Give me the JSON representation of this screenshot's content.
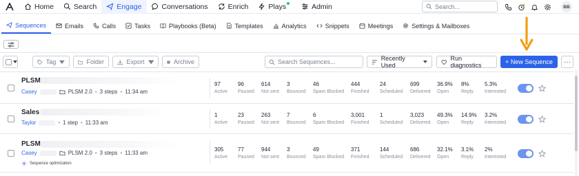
{
  "topnav": {
    "items": [
      {
        "label": "Home",
        "icon": "home-icon"
      },
      {
        "label": "Search",
        "icon": "search-icon"
      },
      {
        "label": "Engage",
        "icon": "engage-icon",
        "active": true
      },
      {
        "label": "Conversations",
        "icon": "chat-icon"
      },
      {
        "label": "Enrich",
        "icon": "enrich-icon"
      },
      {
        "label": "Plays",
        "icon": "bolt-icon"
      },
      {
        "label": "Admin",
        "icon": "admin-icon"
      }
    ],
    "search_placeholder": "Search...",
    "avatar_initials": "BB",
    "accent_color": "#2d5fe8"
  },
  "subnav": {
    "items": [
      {
        "label": "Sequences",
        "active": true
      },
      {
        "label": "Emails"
      },
      {
        "label": "Calls"
      },
      {
        "label": "Tasks"
      },
      {
        "label": "Playbooks (Beta)"
      },
      {
        "label": "Templates"
      },
      {
        "label": "Analytics"
      },
      {
        "label": "Snippets"
      },
      {
        "label": "Meetings"
      },
      {
        "label": "Settings & Mailboxes"
      }
    ]
  },
  "toolbar": {
    "tag_label": "Tag",
    "folder_label": "Folder",
    "export_label": "Export",
    "archive_label": "Archive",
    "search_placeholder": "Search Sequences...",
    "sort_label": "Recently Used",
    "diagnostics_label": "Run diagnostics",
    "new_sequence_label": "+ New Sequence",
    "more_label": "···",
    "button_color": "#2d63e8",
    "annotation_arrow_color": "#f39c12"
  },
  "sequences": [
    {
      "name": "PLSM",
      "owner": "Casey",
      "folder": "PLSM 2.0",
      "steps": "3 steps",
      "time": "11:34 am",
      "optimization": "",
      "stats": [
        {
          "value": "97",
          "label": "Active"
        },
        {
          "value": "96",
          "label": "Paused"
        },
        {
          "value": "614",
          "label": "Not sent"
        },
        {
          "value": "3",
          "label": "Bounced"
        },
        {
          "value": "46",
          "label": "Spam Blocked"
        },
        {
          "value": "444",
          "label": "Finished"
        },
        {
          "value": "24",
          "label": "Scheduled"
        },
        {
          "value": "699",
          "label": "Delivered"
        },
        {
          "value": "36.9%",
          "label": "Open"
        },
        {
          "value": "8%",
          "label": "Reply"
        },
        {
          "value": "5.3%",
          "label": "Interested"
        }
      ]
    },
    {
      "name": "Sales",
      "owner": "Taylor",
      "folder": "",
      "steps": "1 step",
      "time": "11:33 am",
      "optimization": "",
      "stats": [
        {
          "value": "1",
          "label": "Active"
        },
        {
          "value": "23",
          "label": "Paused"
        },
        {
          "value": "263",
          "label": "Not sent"
        },
        {
          "value": "7",
          "label": "Bounced"
        },
        {
          "value": "6",
          "label": "Spam Blocked"
        },
        {
          "value": "3,001",
          "label": "Finished"
        },
        {
          "value": "1",
          "label": "Scheduled"
        },
        {
          "value": "3,023",
          "label": "Delivered"
        },
        {
          "value": "49.3%",
          "label": "Open"
        },
        {
          "value": "14.9%",
          "label": "Reply"
        },
        {
          "value": "3.2%",
          "label": "Interested"
        }
      ]
    },
    {
      "name": "PLSM",
      "owner": "Casey",
      "folder": "PLSM 2.0",
      "steps": "3 steps",
      "time": "11:33 am",
      "optimization": "Sequence optimization",
      "stats": [
        {
          "value": "305",
          "label": "Active"
        },
        {
          "value": "77",
          "label": "Paused"
        },
        {
          "value": "944",
          "label": "Not sent"
        },
        {
          "value": "3",
          "label": "Bounced"
        },
        {
          "value": "49",
          "label": "Spam Blocked"
        },
        {
          "value": "371",
          "label": "Finished"
        },
        {
          "value": "144",
          "label": "Scheduled"
        },
        {
          "value": "686",
          "label": "Delivered"
        },
        {
          "value": "32.1%",
          "label": "Open"
        },
        {
          "value": "3.1%",
          "label": "Reply"
        },
        {
          "value": "2%",
          "label": "Interested"
        }
      ]
    }
  ]
}
